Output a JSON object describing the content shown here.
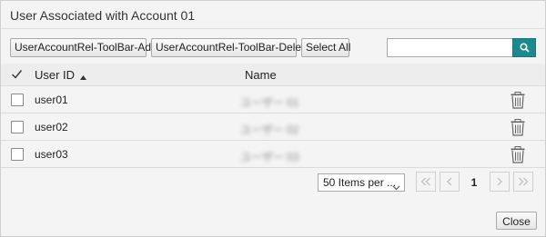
{
  "dialog": {
    "title": "User Associated with Account 01",
    "close_label": "Close"
  },
  "toolbar": {
    "add_label": "UserAccountRel-ToolBar-Add",
    "delete_label": "UserAccountRel-ToolBar-Delete",
    "select_all_label": "Select All"
  },
  "search": {
    "value": "",
    "icon": "search-icon"
  },
  "table": {
    "columns": [
      {
        "label": "User ID",
        "sort": "ascending"
      },
      {
        "label": "Name"
      }
    ],
    "rows": [
      {
        "user_id": "user01",
        "name": "ユーザー 01",
        "checked": false
      },
      {
        "user_id": "user02",
        "name": "ユーザー 02",
        "checked": false
      },
      {
        "user_id": "user03",
        "name": "ユーザー 03",
        "checked": false
      }
    ]
  },
  "pager": {
    "items_per_page": "50 Items per ...",
    "current_page": "1"
  },
  "colors": {
    "accent": "#1a8a8f",
    "background": "#f4f4f4",
    "header_bg": "#ededed"
  }
}
